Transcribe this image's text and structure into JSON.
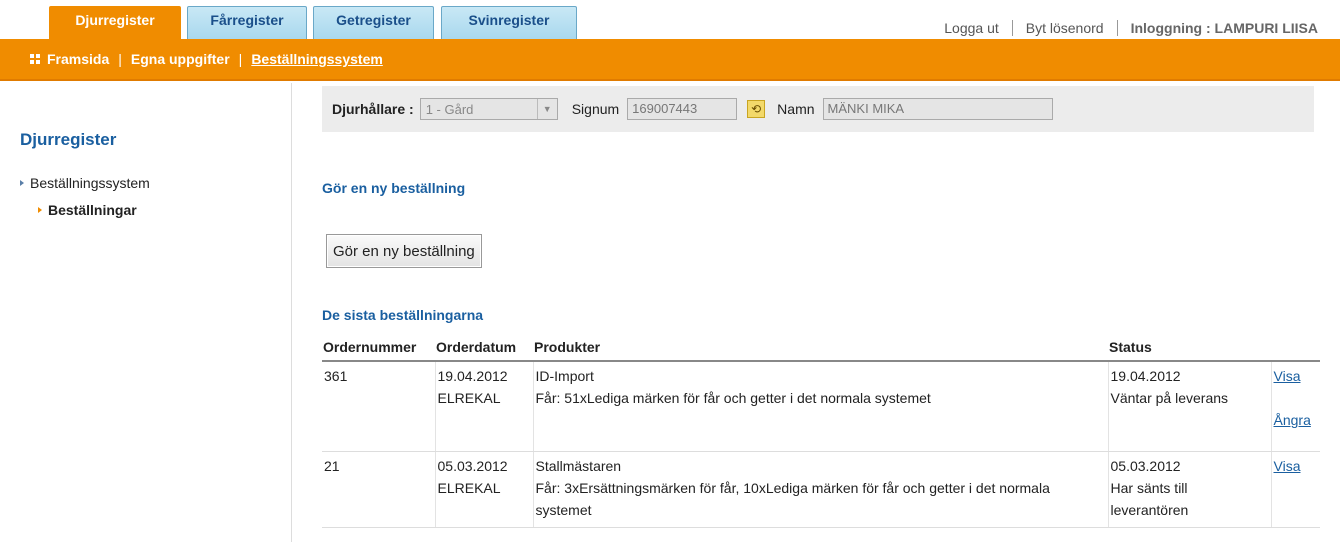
{
  "tabs": [
    {
      "label": "Djurregister",
      "active": true
    },
    {
      "label": "Fårregister",
      "active": false
    },
    {
      "label": "Getregister",
      "active": false
    },
    {
      "label": "Svinregister",
      "active": false
    }
  ],
  "top_links": {
    "logout": "Logga ut",
    "change_password": "Byt lösenord",
    "login_info": "Inloggning : LAMPURI LIISA"
  },
  "nav": {
    "items": [
      "Framsida",
      "Egna uppgifter",
      "Beställningssystem"
    ],
    "separator": "|"
  },
  "sidebar": {
    "title": "Djurregister",
    "items": [
      {
        "label": "Beställningssystem",
        "level": 1
      },
      {
        "label": "Beställningar",
        "level": 2
      }
    ]
  },
  "holder": {
    "holder_label": "Djurhållare :",
    "holder_value": "1 - Gård",
    "signum_label": "Signum",
    "signum_value": "169007443",
    "name_label": "Namn",
    "name_value": "MÄNKI MIKA"
  },
  "new_order": {
    "heading": "Gör en ny beställning",
    "button_label": "Gör en ny beställning"
  },
  "recent": {
    "heading": "De sista beställningarna",
    "columns": [
      "Ordernummer",
      "Orderdatum",
      "Produkter",
      "Status",
      ""
    ],
    "rows": [
      {
        "number": "361",
        "date": "19.04.2012",
        "user": "ELREKAL",
        "product": "ID-Import",
        "details": "Får: 51xLediga märken för får och getter i det normala systemet",
        "status_date": "19.04.2012",
        "status": "Väntar på leverans",
        "view": "Visa",
        "undo": "Ångra"
      },
      {
        "number": "21",
        "date": "05.03.2012",
        "user": "ELREKAL",
        "product": "Stallmästaren",
        "details": "Får: 3xErsättningsmärken för får, 10xLediga märken för får och getter i det normala systemet",
        "status_date": "05.03.2012",
        "status": "Har sänts till leverantören",
        "view": "Visa",
        "undo": ""
      }
    ]
  },
  "colors": {
    "accent_orange": "#f08c00",
    "link_blue": "#1a5fa0",
    "tab_blue": "#a9d8ee"
  }
}
